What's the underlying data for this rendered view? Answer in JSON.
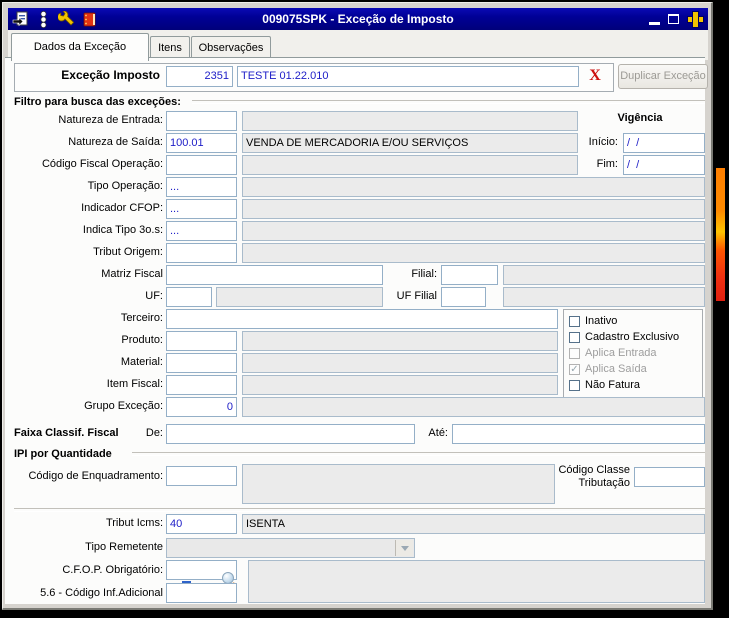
{
  "window": {
    "title": "009075SPK - Exceção de Imposto",
    "toolbar_icons": [
      "report-exit-icon",
      "traffic-light-icon",
      "wrench-icon",
      "notebook-icon"
    ],
    "control_icons": [
      "minimize-icon",
      "maximize-icon",
      "plus-close-icon"
    ]
  },
  "tabs": {
    "items": [
      {
        "label": "Dados da Exceção",
        "active": true
      },
      {
        "label": "Itens",
        "active": false
      },
      {
        "label": "Observações",
        "active": false
      }
    ]
  },
  "header": {
    "label": "Exceção Imposto",
    "code": "2351",
    "description": "TESTE 01.22.010",
    "clear_glyph": "X",
    "duplicate_button": "Duplicar Exceção"
  },
  "sections": {
    "filter": "Filtro para busca das exceções:",
    "vigencia": "Vigência",
    "faixa": "Faixa Classif. Fiscal",
    "ipi": "IPI por Quantidade"
  },
  "fields": {
    "natureza_entrada": {
      "label": "Natureza de Entrada:",
      "value": "",
      "desc": ""
    },
    "natureza_saida": {
      "label": "Natureza de Saída:",
      "value": "100.01",
      "desc": "VENDA DE MERCADORIA E/OU SERVIÇOS"
    },
    "codigo_fiscal_operacao": {
      "label": "Código Fiscal Operação:",
      "value": "",
      "desc": ""
    },
    "tipo_operacao": {
      "label": "Tipo Operação:",
      "value": "...",
      "desc": ""
    },
    "indicador_cfop": {
      "label": "Indicador CFOP:",
      "value": "...",
      "desc": ""
    },
    "indica_tipo_3os": {
      "label": "Indica Tipo 3o.s:",
      "value": "...",
      "desc": ""
    },
    "tribut_origem": {
      "label": "Tribut Origem:",
      "value": "",
      "desc": ""
    },
    "matriz_fiscal": {
      "label": "Matriz Fiscal",
      "value": ""
    },
    "filial": {
      "label": "Filial:",
      "value": "",
      "desc": ""
    },
    "uf": {
      "label": "UF:",
      "value": "",
      "desc": ""
    },
    "uf_filial": {
      "label": "UF Filial",
      "value": "",
      "desc": ""
    },
    "terceiro": {
      "label": "Terceiro:",
      "value": ""
    },
    "produto": {
      "label": "Produto:",
      "value": "",
      "desc": ""
    },
    "material": {
      "label": "Material:",
      "value": "",
      "desc": ""
    },
    "item_fiscal": {
      "label": "Item Fiscal:",
      "value": "",
      "desc": ""
    },
    "grupo_excecao": {
      "label": "Grupo Exceção:",
      "value": "0",
      "desc": ""
    },
    "inicio": {
      "label": "Início:",
      "value": "/  /"
    },
    "fim": {
      "label": "Fim:",
      "value": "/  /"
    },
    "faixa_de": {
      "label": "De:",
      "value": ""
    },
    "faixa_ate": {
      "label": "Até:",
      "value": ""
    },
    "codigo_enquadramento": {
      "label": "Código de Enquadramento:",
      "value": "",
      "desc": ""
    },
    "codigo_classe": {
      "label1": "Código Classe",
      "label2": "Tributação",
      "value": ""
    },
    "tribut_icms": {
      "label": "Tribut Icms:",
      "value": "40",
      "desc": "ISENTA"
    },
    "tipo_remetente": {
      "label": "Tipo Remetente",
      "value": ""
    },
    "cfop_obrigatorio": {
      "label": "C.F.O.P. Obrigatório:",
      "value": "...",
      "desc": ""
    },
    "codigo_inf_adicional": {
      "label": "5.6 - Código Inf.Adicional",
      "value": "",
      "desc": ""
    }
  },
  "checkboxes": {
    "items": [
      {
        "label": "Inativo",
        "checked": false,
        "disabled": false
      },
      {
        "label": "Cadastro Exclusivo",
        "checked": false,
        "disabled": false
      },
      {
        "label": "Aplica Entrada",
        "checked": false,
        "disabled": true
      },
      {
        "label": "Aplica Saída",
        "checked": true,
        "disabled": true
      },
      {
        "label": "Não Fatura",
        "checked": false,
        "disabled": false
      }
    ],
    "check_glyph": "✓"
  },
  "colors": {
    "titlebar": "#000096",
    "value_text": "#2020C8",
    "clear_x": "#CC1111",
    "accent_strip_top": "#FF7F00",
    "accent_strip_bottom": "#E02010"
  }
}
